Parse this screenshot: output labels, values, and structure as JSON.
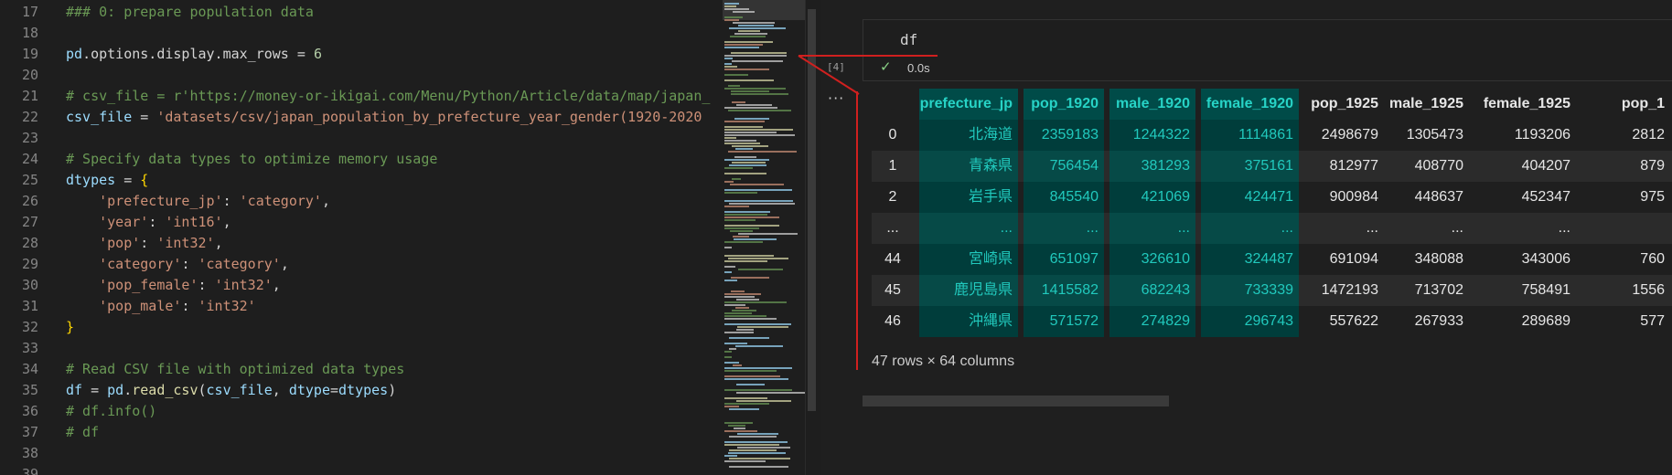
{
  "editor": {
    "lines": [
      {
        "no": "17",
        "tokens": [
          {
            "t": "### 0: prepare population data",
            "c": "comment"
          }
        ]
      },
      {
        "no": "18",
        "tokens": []
      },
      {
        "no": "19",
        "tokens": [
          {
            "t": "pd",
            "c": "var"
          },
          {
            "t": ".options.display.max_rows = ",
            "c": "ident"
          },
          {
            "t": "6",
            "c": "number"
          }
        ]
      },
      {
        "no": "20",
        "tokens": []
      },
      {
        "no": "21",
        "tokens": [
          {
            "t": "# csv_file = r'https://money-or-ikigai.com/Menu/Python/Article/data/map/japan_",
            "c": "comment"
          }
        ]
      },
      {
        "no": "22",
        "tokens": [
          {
            "t": "csv_file",
            "c": "var"
          },
          {
            "t": " = ",
            "c": "op"
          },
          {
            "t": "'datasets/csv/japan_population_by_prefecture_year_gender(1920-2020",
            "c": "string"
          }
        ]
      },
      {
        "no": "23",
        "tokens": []
      },
      {
        "no": "24",
        "tokens": [
          {
            "t": "# Specify data types to optimize memory usage",
            "c": "comment"
          }
        ]
      },
      {
        "no": "25",
        "tokens": [
          {
            "t": "dtypes",
            "c": "var"
          },
          {
            "t": " = ",
            "c": "op"
          },
          {
            "t": "{",
            "c": "brace"
          }
        ]
      },
      {
        "no": "26",
        "tokens": [
          {
            "t": "    'prefecture_jp'",
            "c": "string"
          },
          {
            "t": ": ",
            "c": "op"
          },
          {
            "t": "'category'",
            "c": "string"
          },
          {
            "t": ",",
            "c": "op"
          }
        ]
      },
      {
        "no": "27",
        "tokens": [
          {
            "t": "    'year'",
            "c": "string"
          },
          {
            "t": ": ",
            "c": "op"
          },
          {
            "t": "'int16'",
            "c": "string"
          },
          {
            "t": ",",
            "c": "op"
          }
        ]
      },
      {
        "no": "28",
        "tokens": [
          {
            "t": "    'pop'",
            "c": "string"
          },
          {
            "t": ": ",
            "c": "op"
          },
          {
            "t": "'int32'",
            "c": "string"
          },
          {
            "t": ",",
            "c": "op"
          }
        ]
      },
      {
        "no": "29",
        "tokens": [
          {
            "t": "    'category'",
            "c": "string"
          },
          {
            "t": ": ",
            "c": "op"
          },
          {
            "t": "'category'",
            "c": "string"
          },
          {
            "t": ",",
            "c": "op"
          }
        ]
      },
      {
        "no": "30",
        "tokens": [
          {
            "t": "    'pop_female'",
            "c": "string"
          },
          {
            "t": ": ",
            "c": "op"
          },
          {
            "t": "'int32'",
            "c": "string"
          },
          {
            "t": ",",
            "c": "op"
          }
        ]
      },
      {
        "no": "31",
        "tokens": [
          {
            "t": "    'pop_male'",
            "c": "string"
          },
          {
            "t": ": ",
            "c": "op"
          },
          {
            "t": "'int32'",
            "c": "string"
          }
        ]
      },
      {
        "no": "32",
        "tokens": [
          {
            "t": "}",
            "c": "brace"
          }
        ]
      },
      {
        "no": "33",
        "tokens": []
      },
      {
        "no": "34",
        "tokens": [
          {
            "t": "# Read CSV file with optimized data types",
            "c": "comment"
          }
        ]
      },
      {
        "no": "35",
        "tokens": [
          {
            "t": "df",
            "c": "var"
          },
          {
            "t": " = ",
            "c": "op"
          },
          {
            "t": "pd",
            "c": "var"
          },
          {
            "t": ".",
            "c": "op"
          },
          {
            "t": "read_csv",
            "c": "func"
          },
          {
            "t": "(",
            "c": "op"
          },
          {
            "t": "csv_file",
            "c": "var"
          },
          {
            "t": ", ",
            "c": "op"
          },
          {
            "t": "dtype",
            "c": "var"
          },
          {
            "t": "=",
            "c": "op"
          },
          {
            "t": "dtypes",
            "c": "var"
          },
          {
            "t": ")",
            "c": "op"
          }
        ]
      },
      {
        "no": "36",
        "tokens": [
          {
            "t": "# df.info()",
            "c": "comment"
          }
        ]
      },
      {
        "no": "37",
        "tokens": [
          {
            "t": "# df",
            "c": "comment"
          }
        ]
      },
      {
        "no": "38",
        "tokens": []
      },
      {
        "no": "39",
        "tokens": []
      }
    ]
  },
  "cell": {
    "code": "df",
    "status_icon": "✓",
    "duration": "0.0s",
    "execution_count": "[4]",
    "output_menu": "···"
  },
  "dataframe": {
    "columns": [
      "",
      "prefecture_jp",
      "pop_1920",
      "male_1920",
      "female_1920",
      "pop_1925",
      "male_1925",
      "female_1925",
      "pop_1"
    ],
    "highlight_columns": [
      1,
      2,
      3,
      4
    ],
    "rows": [
      [
        "0",
        "北海道",
        "2359183",
        "1244322",
        "1114861",
        "2498679",
        "1305473",
        "1193206",
        "2812"
      ],
      [
        "1",
        "青森県",
        "756454",
        "381293",
        "375161",
        "812977",
        "408770",
        "404207",
        "879"
      ],
      [
        "2",
        "岩手県",
        "845540",
        "421069",
        "424471",
        "900984",
        "448637",
        "452347",
        "975"
      ],
      [
        "...",
        "...",
        "...",
        "...",
        "...",
        "...",
        "...",
        "...",
        ""
      ],
      [
        "44",
        "宮崎県",
        "651097",
        "326610",
        "324487",
        "691094",
        "348088",
        "343006",
        "760"
      ],
      [
        "45",
        "鹿児島県",
        "1415582",
        "682243",
        "733339",
        "1472193",
        "713702",
        "758491",
        "1556"
      ],
      [
        "46",
        "沖縄県",
        "571572",
        "274829",
        "296743",
        "557622",
        "267933",
        "289689",
        "577"
      ]
    ],
    "shape_text": "47 rows × 64 columns"
  },
  "colors": {
    "highlight_bg": "#003d3b",
    "highlight_text": "#21c9bd",
    "annotation": "#d0201f"
  }
}
